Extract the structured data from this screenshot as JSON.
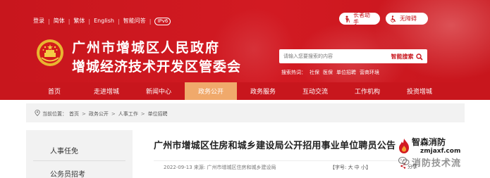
{
  "top_links": [
    "登录",
    "简体",
    "繁体",
    "English",
    "智能问答"
  ],
  "ipv6_badge": "IPv6",
  "elder_mode": "长者助手",
  "accessibility": "无障碍",
  "site_title_line1": "广州市增城区人民政府",
  "site_title_line2": "增城经济技术开发区管委会",
  "search": {
    "placeholder": "请输入您要搜索的内容",
    "button_label": "智能搜索"
  },
  "hot_words": {
    "label": "搜索热词：",
    "items": [
      "社保",
      "医保",
      "单位招聘",
      "营商环境"
    ]
  },
  "nav": {
    "items": [
      "首页",
      "走进增城",
      "新闻中心",
      "政务公开",
      "政务服务",
      "互动交流",
      "工作机构",
      "投资增城"
    ],
    "active": "政务公开"
  },
  "breadcrumb": {
    "label": "当前位置：",
    "items": [
      "首页",
      "政务公开",
      "人事工作",
      "单位招聘"
    ]
  },
  "sidebar": {
    "items": [
      "人事任免",
      "公务员招考"
    ]
  },
  "article": {
    "title": "广州市增城区住房和城乡建设局公开招用事业单位聘员公告",
    "date_source": "2022-09-13 来源: 广州市增城区住房和城乡建设局",
    "font_size": "【字号: 大 中 小】",
    "share": "分享"
  },
  "watermark": {
    "brand": "智森消防",
    "site": "zmjaxf.com",
    "tech": "消防技术流"
  },
  "colors": {
    "primary_red": "#c8161d",
    "nav_active": "#f0a96b",
    "panel_gray": "#f2f2f2"
  }
}
